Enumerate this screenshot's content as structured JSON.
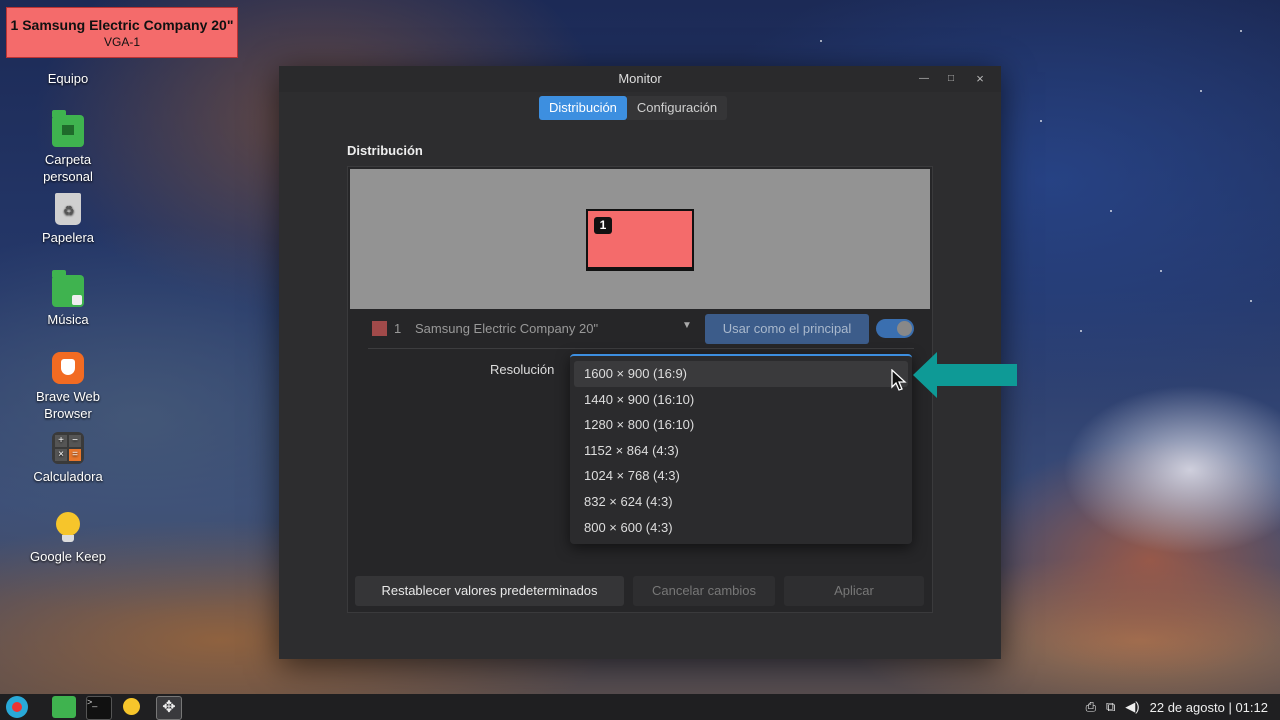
{
  "notification": {
    "title": "1  Samsung Electric Company 20\"",
    "subtitle": "VGA-1"
  },
  "desktop": {
    "icons": [
      {
        "label": "Equipo"
      },
      {
        "label": "Carpeta personal"
      },
      {
        "label": "Papelera"
      },
      {
        "label": "Música"
      },
      {
        "label": "Brave Web Browser"
      },
      {
        "label": "Calculadora"
      },
      {
        "label": "Google Keep"
      }
    ]
  },
  "window": {
    "title": "Monitor",
    "tabs": [
      {
        "label": "Distribución",
        "active": true
      },
      {
        "label": "Configuración",
        "active": false
      }
    ],
    "section_title": "Distribución",
    "monitor_badge": "1",
    "monitor_selector": {
      "number": "1",
      "name": "Samsung Electric Company 20\""
    },
    "primary_button": "Usar como el principal",
    "toggle_on": true,
    "resolution_label": "Resolución",
    "resolution_options": [
      "1600 × 900 (16:9)",
      "1440 × 900 (16:10)",
      "1280 × 800 (16:10)",
      "1152 × 864 (4:3)",
      "1024 × 768 (4:3)",
      "832 × 624 (4:3)",
      "800 × 600 (4:3)"
    ],
    "highlighted_option_index": 0,
    "buttons": {
      "reset": "Restablecer valores predeterminados",
      "cancel": "Cancelar cambios",
      "apply": "Aplicar"
    }
  },
  "taskbar": {
    "date": "22 de agosto",
    "time": "01:12",
    "separator": "|"
  },
  "colors": {
    "accent": "#3d8fe0",
    "monitor": "#f46b6b",
    "arrow": "#0e9a96"
  }
}
